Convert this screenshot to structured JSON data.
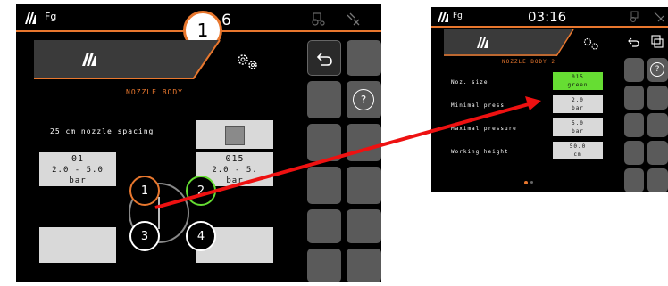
{
  "left": {
    "topbar": {
      "app_label": "Fg",
      "time_partial": "6",
      "callout_number": "1"
    },
    "header": {
      "title": "NOZZLE BODY"
    },
    "spacing": {
      "label": "25 cm nozzle spacing"
    },
    "nozzle_left": {
      "size": "01",
      "pressure": "2.0  -  5.0",
      "unit": "bar"
    },
    "nozzle_right": {
      "size": "015",
      "pressure": "2.0  -  5.",
      "unit": "bar"
    },
    "nozzles": [
      "1",
      "2",
      "3",
      "4"
    ]
  },
  "right": {
    "topbar": {
      "app_label": "Fg",
      "time": "03:16"
    },
    "header": {
      "title": "NOZZLE BODY 2"
    },
    "rows": [
      {
        "label": "Noz. size",
        "value": "015",
        "sub": "green"
      },
      {
        "label": "Minimal press",
        "value": "2.0",
        "sub": "bar"
      },
      {
        "label": "Maximal pressure",
        "value": "5.0",
        "sub": "bar"
      },
      {
        "label": "Working height",
        "value": "50.0",
        "sub": "cm"
      }
    ],
    "help": "?"
  },
  "colors": {
    "accent": "#e8772e",
    "green": "#66dd33",
    "arrow": "#ee1111"
  },
  "icons": [
    "terminal-logo-icon",
    "settings-gears-icon",
    "back-arrow-icon",
    "help-icon",
    "satellite-icon",
    "tractor-icon"
  ]
}
